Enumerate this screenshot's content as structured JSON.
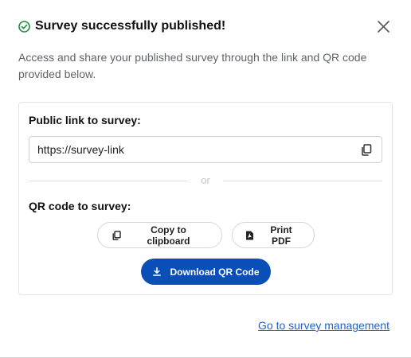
{
  "dialog": {
    "title": "Survey successfully published!",
    "description": "Access and share your published survey through the link and QR code provided below.",
    "success_icon": "check-circle-icon",
    "close_icon": "close-icon",
    "accent_color": "#0a4fb8",
    "success_color": "#1e8e3e",
    "link_color": "#1a63d8"
  },
  "card": {
    "public_link_label": "Public link to survey:",
    "link_value": "https://survey-link",
    "copy_icon": "copy-icon",
    "divider_text": "or",
    "qr_label": "QR code to survey:",
    "copy_clipboard_label": "Copy to clipboard",
    "print_pdf_label": "Print PDF",
    "download_label": "Download QR Code"
  },
  "footer": {
    "manage_link": "Go to survey management"
  }
}
